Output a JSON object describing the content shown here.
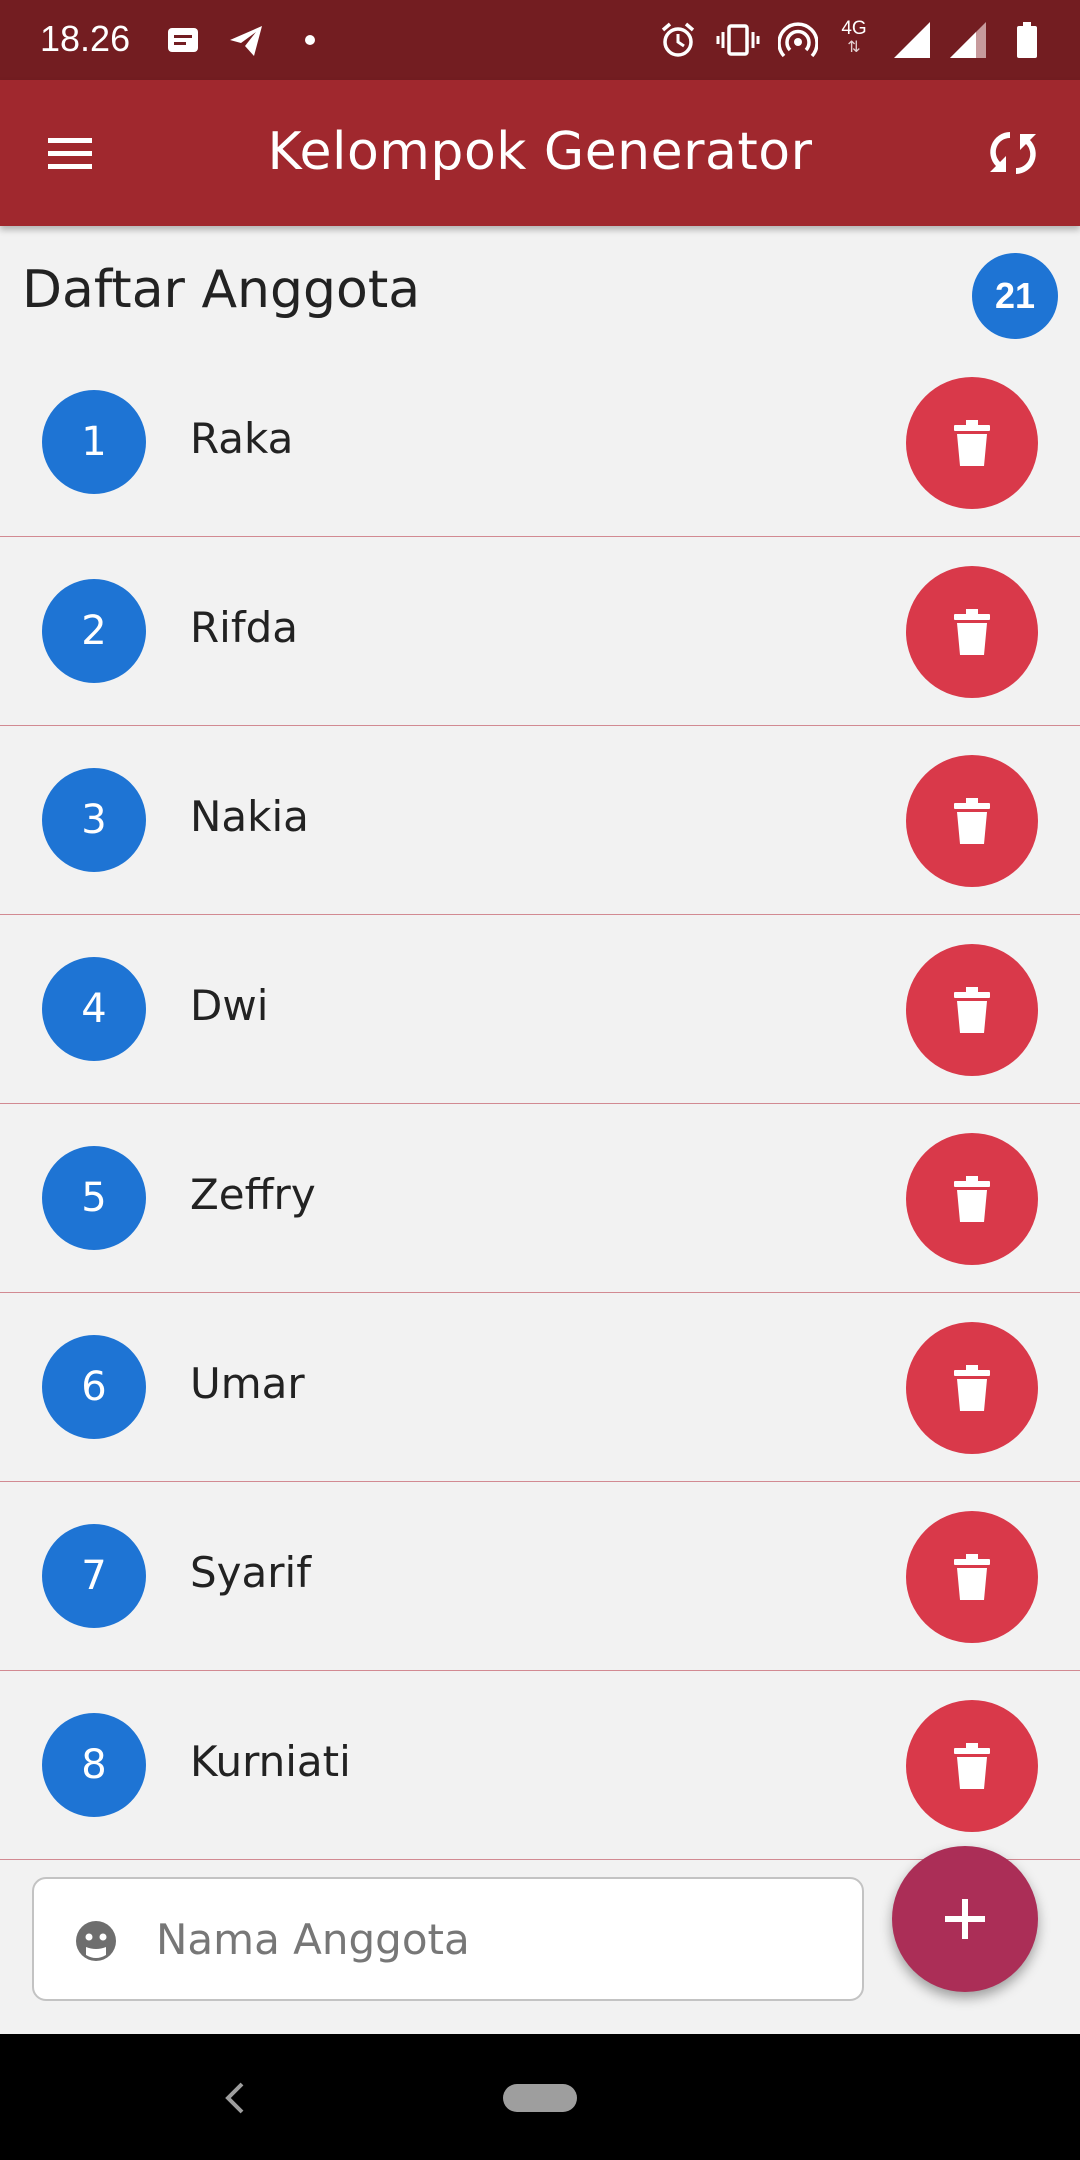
{
  "status_bar": {
    "time": "18.26",
    "network_label": "4G",
    "icons": [
      "message-icon",
      "telegram-icon",
      "dot-icon",
      "alarm-icon",
      "vibrate-icon",
      "hotspot-icon",
      "network-4g-icon",
      "signal-icon",
      "signal-icon-2",
      "battery-icon"
    ]
  },
  "app_bar": {
    "title": "Kelompok Generator",
    "left_icon": "menu-icon",
    "right_icon": "shuffle-icon"
  },
  "list": {
    "title": "Daftar Anggota",
    "count": "21",
    "items": [
      {
        "number": "1",
        "name": "Raka"
      },
      {
        "number": "2",
        "name": "Rifda"
      },
      {
        "number": "3",
        "name": "Nakia"
      },
      {
        "number": "4",
        "name": "Dwi"
      },
      {
        "number": "5",
        "name": "Zeffry"
      },
      {
        "number": "6",
        "name": "Umar"
      },
      {
        "number": "7",
        "name": "Syarif"
      },
      {
        "number": "8",
        "name": "Kurniati"
      }
    ]
  },
  "input": {
    "placeholder": "Nama Anggota",
    "value": "",
    "icon": "face-icon"
  },
  "fab": {
    "icon": "plus-icon"
  },
  "colors": {
    "status_bar": "#731d21",
    "app_bar": "#a0282e",
    "badge_blue": "#1e74d4",
    "delete_red": "#d9394a",
    "fab": "#ab2e57",
    "background": "#f2f2f2"
  }
}
